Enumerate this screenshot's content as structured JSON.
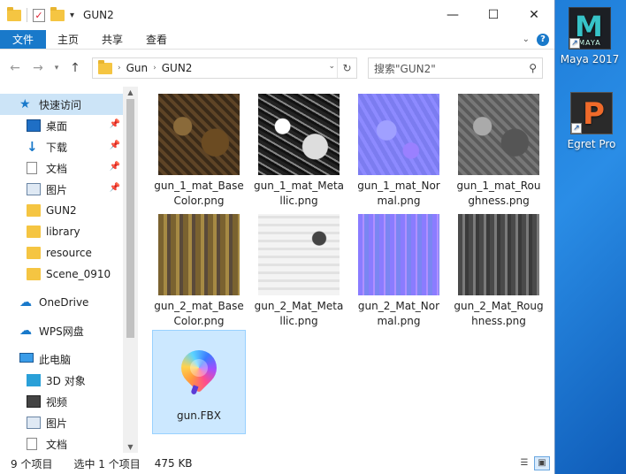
{
  "desktop": {
    "icons": [
      {
        "label": "Maya 2017",
        "glyph": "M",
        "sub": "MAYA"
      },
      {
        "label": "Egret Pro",
        "glyph": "P"
      }
    ]
  },
  "window": {
    "title": "GUN2",
    "controls": {
      "minimize": "—",
      "maximize": "☐",
      "close": "✕"
    }
  },
  "ribbon": {
    "tabs": [
      "文件",
      "主页",
      "共享",
      "查看"
    ]
  },
  "nav": {
    "breadcrumb": [
      "Gun",
      "GUN2"
    ],
    "search_placeholder": "搜索\"GUN2\""
  },
  "sidebar": {
    "quick_access": "快速访问",
    "pinned": [
      "桌面",
      "下载",
      "文档",
      "图片"
    ],
    "folders": [
      "GUN2",
      "library",
      "resource",
      "Scene_0910"
    ],
    "onedrive": "OneDrive",
    "wps": "WPS网盘",
    "this_pc": "此电脑",
    "pc_items": [
      "3D 对象",
      "视频",
      "图片",
      "文档"
    ]
  },
  "files": [
    {
      "name": "gun_1_mat_BaseColor.png",
      "kind": "tex-base1"
    },
    {
      "name": "gun_1_mat_Metallic.png",
      "kind": "tex-metal1"
    },
    {
      "name": "gun_1_mat_Normal.png",
      "kind": "tex-norm1"
    },
    {
      "name": "gun_1_mat_Roughness.png",
      "kind": "tex-rough1"
    },
    {
      "name": "gun_2_mat_BaseColor.png",
      "kind": "tex-base2"
    },
    {
      "name": "gun_2_Mat_Metallic.png",
      "kind": "tex-metal2"
    },
    {
      "name": "gun_2_Mat_Normal.png",
      "kind": "tex-norm2"
    },
    {
      "name": "gun_2_Mat_Roughness.png",
      "kind": "tex-rough2"
    },
    {
      "name": "gun.FBX",
      "kind": "fbx",
      "selected": true
    }
  ],
  "status": {
    "count": "9 个项目",
    "selected": "选中 1 个项目",
    "size": "475 KB"
  },
  "colors": {
    "accent": "#1979ca",
    "selection": "#cce8ff"
  }
}
